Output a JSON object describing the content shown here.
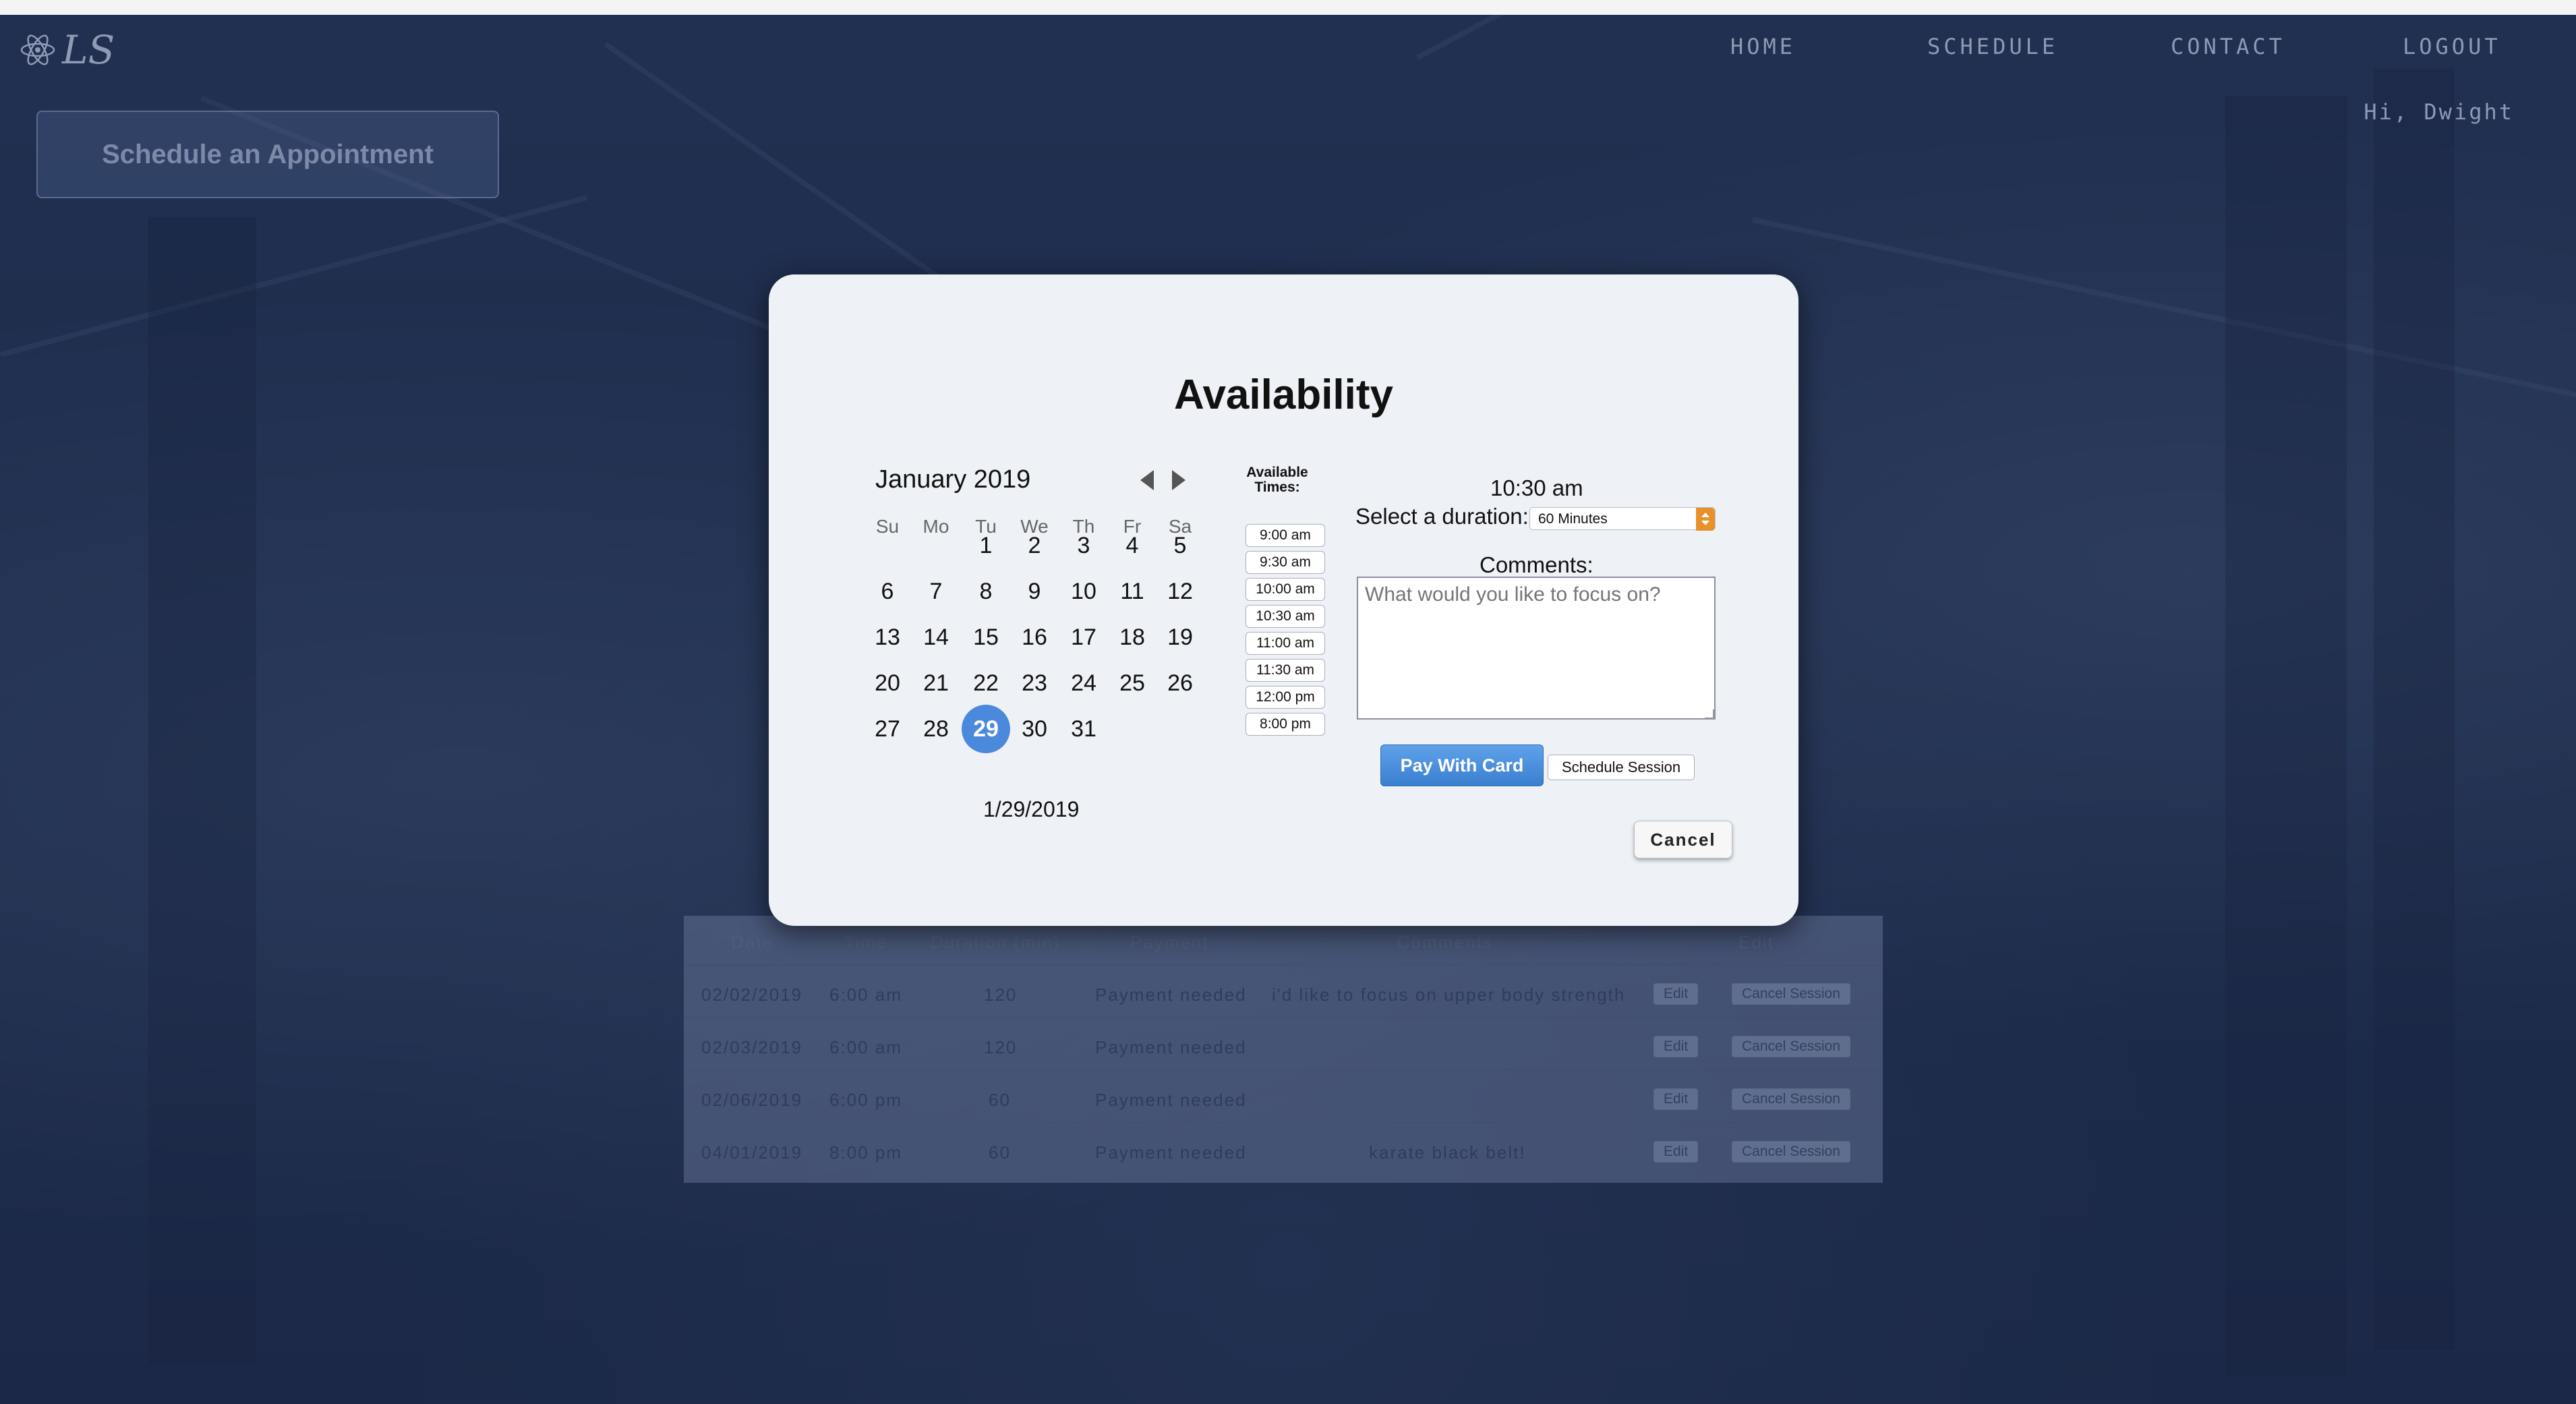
{
  "nav": {
    "brand": "LS",
    "items": [
      "HOME",
      "SCHEDULE",
      "CONTACT",
      "LOGOUT"
    ],
    "greeting": "Hi, Dwight"
  },
  "schedule_button": "Schedule an Appointment",
  "table": {
    "headers": [
      "Date",
      "Time",
      "Duration (min)",
      "Payment",
      "Comments",
      "Edit"
    ],
    "rows": [
      {
        "date": "02/02/2019",
        "time": "6:00 am",
        "duration": "120",
        "payment": "Payment needed",
        "comments": "i'd like to focus on upper body strength",
        "edit": "Edit",
        "cancel": "Cancel Session"
      },
      {
        "date": "02/03/2019",
        "time": "6:00 am",
        "duration": "120",
        "payment": "Payment needed",
        "comments": "",
        "edit": "Edit",
        "cancel": "Cancel Session"
      },
      {
        "date": "02/06/2019",
        "time": "6:00 pm",
        "duration": "60",
        "payment": "Payment needed",
        "comments": "",
        "edit": "Edit",
        "cancel": "Cancel Session"
      },
      {
        "date": "04/01/2019",
        "time": "8:00 pm",
        "duration": "60",
        "payment": "Payment needed",
        "comments": "karate black belt!",
        "edit": "Edit",
        "cancel": "Cancel Session"
      }
    ]
  },
  "modal": {
    "title": "Availability",
    "calendar": {
      "month_label": "January 2019",
      "weekdays": [
        "Su",
        "Mo",
        "Tu",
        "We",
        "Th",
        "Fr",
        "Sa"
      ],
      "first_weekday_index": 2,
      "days_in_month": 31,
      "selected_day": 29,
      "selected_date": "1/29/2019"
    },
    "times_header": "Available Times:",
    "times": [
      "9:00 am",
      "9:30 am",
      "10:00 am",
      "10:30 am",
      "11:00 am",
      "11:30 am",
      "12:00 pm",
      "8:00 pm"
    ],
    "selected_time": "10:30 am",
    "duration_label": "Select a duration:",
    "duration_value": "60 Minutes",
    "comments_label": "Comments:",
    "comments_placeholder": "What would you like to focus on?",
    "pay_button": "Pay With Card",
    "schedule_session_button": "Schedule Session",
    "cancel_button": "Cancel"
  },
  "colors": {
    "accent": "#4a89dc",
    "select_caret": "#e8912a",
    "background": "#1b2a49"
  }
}
